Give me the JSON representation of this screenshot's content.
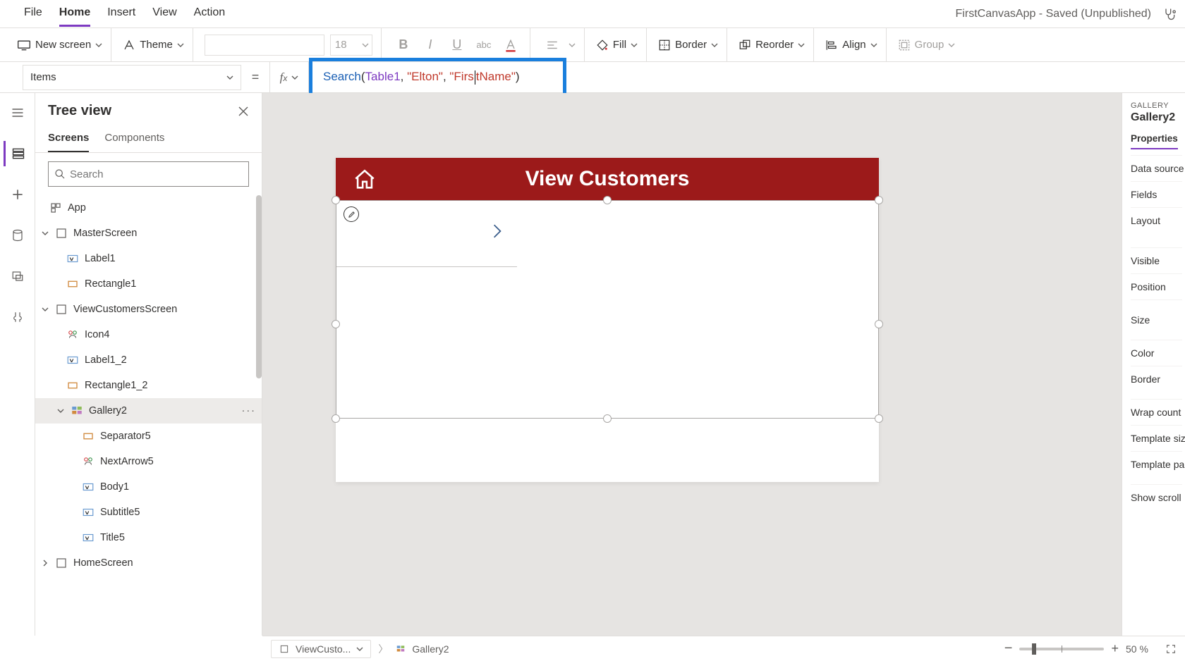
{
  "app_title": "FirstCanvasApp - Saved (Unpublished)",
  "menu": {
    "file": "File",
    "home": "Home",
    "insert": "Insert",
    "view": "View",
    "action": "Action"
  },
  "ribbon": {
    "new_screen": "New screen",
    "theme": "Theme",
    "font_size": "18",
    "fill": "Fill",
    "border": "Border",
    "reorder": "Reorder",
    "align": "Align",
    "group": "Group"
  },
  "formula": {
    "property": "Items",
    "fn": "Search",
    "arg1": "Table1",
    "arg2": "\"Elton\"",
    "arg3a": "\"Firs",
    "arg3b": "tName\""
  },
  "tree": {
    "title": "Tree view",
    "tab_screens": "Screens",
    "tab_components": "Components",
    "search_placeholder": "Search",
    "items": {
      "app": "App",
      "master": "MasterScreen",
      "label1": "Label1",
      "rect1": "Rectangle1",
      "viewcust": "ViewCustomersScreen",
      "icon4": "Icon4",
      "label12": "Label1_2",
      "rect12": "Rectangle1_2",
      "gallery2": "Gallery2",
      "sep5": "Separator5",
      "next5": "NextArrow5",
      "body1": "Body1",
      "sub5": "Subtitle5",
      "title5": "Title5",
      "home": "HomeScreen"
    }
  },
  "canvas": {
    "header_title": "View Customers"
  },
  "props": {
    "category": "GALLERY",
    "name": "Gallery2",
    "tab": "Properties",
    "rows": {
      "datasource": "Data source",
      "fields": "Fields",
      "layout": "Layout",
      "visible": "Visible",
      "position": "Position",
      "size": "Size",
      "color": "Color",
      "border": "Border",
      "wrap": "Wrap count",
      "tsize": "Template size",
      "tpad": "Template pa",
      "scroll": "Show scroll"
    }
  },
  "status": {
    "crumb1": "ViewCusto...",
    "crumb2": "Gallery2",
    "zoom": "50 %"
  }
}
